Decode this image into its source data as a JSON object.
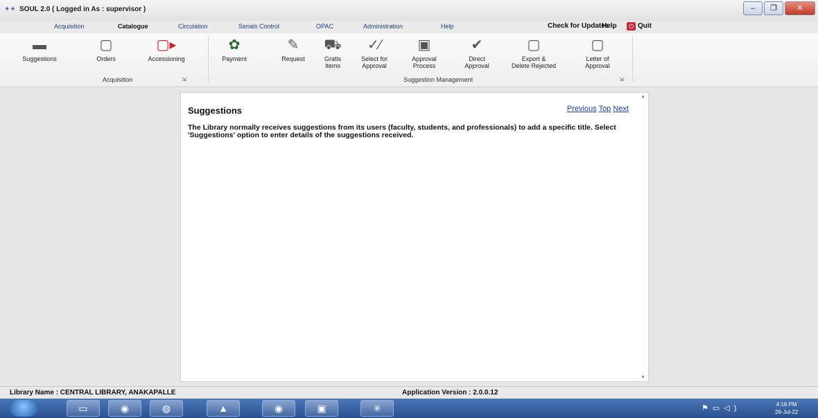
{
  "window": {
    "title": "SOUL 2.0  ( Logged in As : supervisor )",
    "controls": {
      "minimize": "–",
      "restore": "❐",
      "close": "✕"
    }
  },
  "tabs": [
    {
      "label": "Acquisition"
    },
    {
      "label": "Catalogue"
    },
    {
      "label": "Circulation"
    },
    {
      "label": "Serials Control"
    },
    {
      "label": "OPAC"
    },
    {
      "label": "Administration"
    },
    {
      "label": "Help"
    }
  ],
  "top_right": {
    "check_updates": "Check for Updates",
    "help": "Help",
    "quit": "Quit"
  },
  "ribbon": {
    "buttons": [
      {
        "label": "Suggestions",
        "icon": "suggestions-icon"
      },
      {
        "label": "Orders",
        "icon": "orders-icon"
      },
      {
        "label": "Accessioning",
        "icon": "accessioning-icon"
      },
      {
        "label": "Payment",
        "icon": "payment-icon"
      },
      {
        "label": "Request",
        "icon": "request-icon"
      },
      {
        "label": "Gratis",
        "label2": "Items",
        "icon": "gratis-items-icon"
      },
      {
        "label": "Select for",
        "label2": "Approval",
        "icon": "select-approval-icon"
      },
      {
        "label": "Approval",
        "label2": "Process",
        "icon": "approval-process-icon"
      },
      {
        "label": "Direct",
        "label2": "Approval",
        "icon": "direct-approval-icon"
      },
      {
        "label": "Export &",
        "label2": "Delete Rejected",
        "icon": "export-delete-icon"
      },
      {
        "label": "Letter of",
        "label2": "Approval",
        "icon": "letter-approval-icon"
      }
    ],
    "groups": {
      "acquisition": "Acquisition",
      "suggestion_management": "Suggestion Management",
      "launcher": "⇲"
    }
  },
  "help_panel": {
    "heading": "Suggestions",
    "nav_previous": "Previous",
    "nav_top": "Top",
    "nav_next": "Next",
    "body": "The Library normally receives suggestions from its users (faculty, students, and professionals) to add a specific title. Select 'Suggestions' option to enter details of the suggestions received."
  },
  "statusbar": {
    "library_name_label": "Library Name : CENTRAL LIBRARY, ANAKAPALLE",
    "version": "Application Version : 2.0.0.12"
  },
  "taskbar": {
    "clock_time": "4:16 PM",
    "clock_date": "26-Jul-22"
  }
}
